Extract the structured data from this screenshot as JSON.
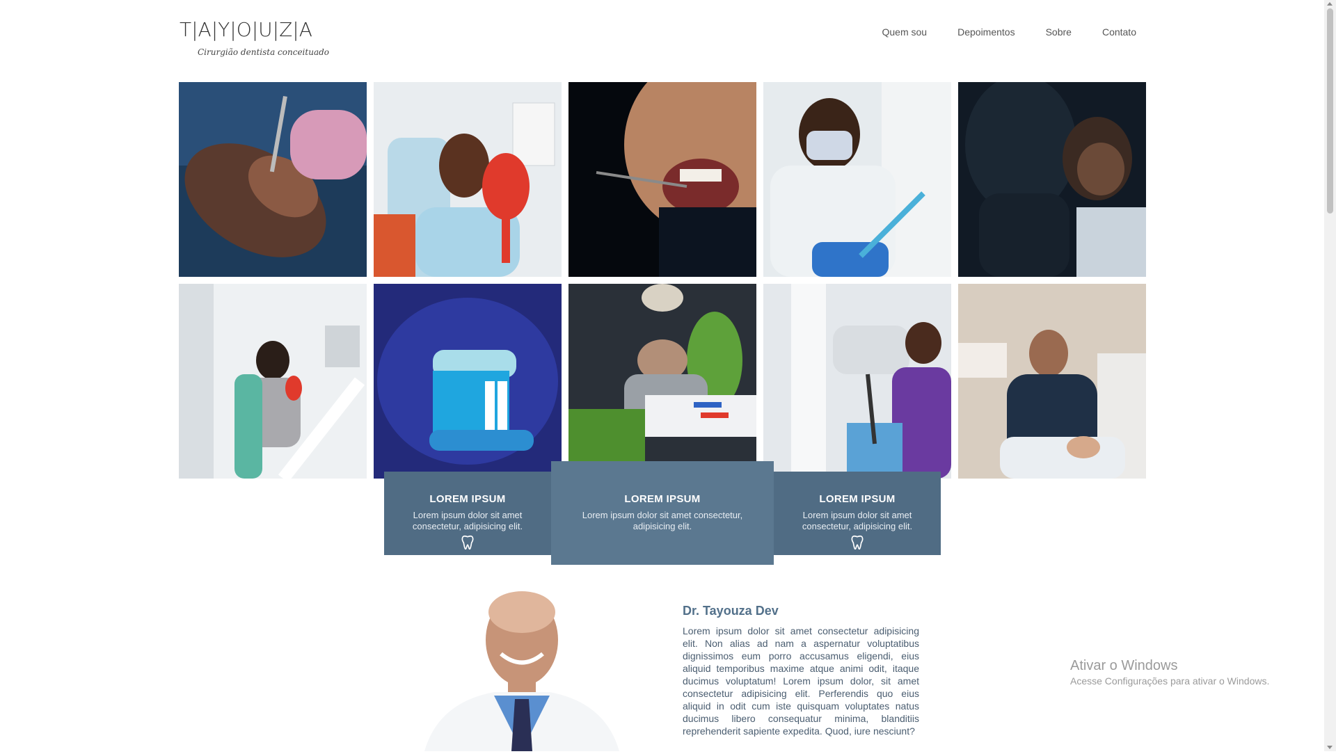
{
  "brand": {
    "logo_letters": [
      "T",
      "|",
      "A",
      "|",
      "Y",
      "|",
      "O",
      "|",
      "U",
      "|",
      "Z",
      "|",
      "A"
    ],
    "tagline": "Cirurgião dentista conceituado"
  },
  "nav": {
    "items": [
      "Quem sou",
      "Depoimentos",
      "Sobre",
      "Contato"
    ]
  },
  "gallery": {
    "photos": [
      "patient-reclined-dental-exam",
      "smiling-patient-with-red-mirror",
      "close-up-mouth-dental-tool",
      "dentist-in-mask-looking-down",
      "child-patient-dark-room",
      "young-man-in-dental-chair",
      "toothbrush-with-paste",
      "dental-instrument-tray",
      "dentist-with-microscope",
      "dentist-treating-patient"
    ]
  },
  "cards": [
    {
      "title": "LOREM IPSUM",
      "text": "Lorem ipsum dolor sit amet consectetur, adipisicing elit.",
      "icon": "tooth-icon"
    },
    {
      "title": "LOREM IPSUM",
      "text": "Lorem ipsum dolor sit amet consectetur, adipisicing elit."
    },
    {
      "title": "LOREM IPSUM",
      "text": "Lorem ipsum dolor sit amet consectetur, adipisicing elit.",
      "icon": "tooth-icon"
    }
  ],
  "doctor": {
    "name": "Dr. Tayouza Dev",
    "bio": "Lorem ipsum dolor sit amet consectetur adipisicing elit. Non alias ad nam a aspernatur voluptatibus dignissimos eum porro accusamus eligendi, eius aliquid temporibus maxime atque animi odit, itaque ducimus voluptatum! Lorem ipsum dolor, sit amet consectetur adipisicing elit. Perferendis quo eius aliquid in odit cum iste quisquam voluptates natus ducimus libero consequatur minima, blanditiis reprehenderit sapiente expedita. Quod, iure nesciunt?"
  },
  "watermark": {
    "title": "Ativar o Windows",
    "subtitle": "Acesse Configurações para ativar o Windows."
  },
  "colors": {
    "card": "#506c84",
    "card_center": "#5b7890",
    "doctor_name": "#52708a"
  }
}
